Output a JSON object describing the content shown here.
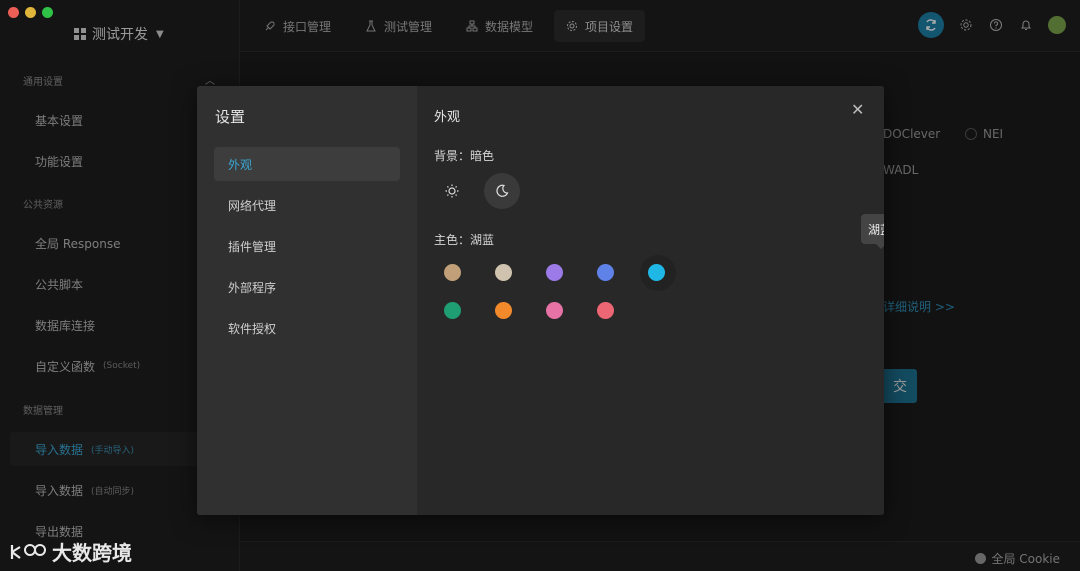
{
  "app": {
    "project_name": "测试开发"
  },
  "sidebar": {
    "sections": [
      {
        "title": "通用设置",
        "items": [
          {
            "label": "基本设置",
            "sub": ""
          },
          {
            "label": "功能设置",
            "sub": ""
          }
        ]
      },
      {
        "title": "公共资源",
        "items": [
          {
            "label": "全局 Response",
            "sub": ""
          },
          {
            "label": "公共脚本",
            "sub": ""
          },
          {
            "label": "数据库连接",
            "sub": ""
          },
          {
            "label": "自定义函数",
            "sub": "(Socket)"
          }
        ]
      },
      {
        "title": "数据管理",
        "items": [
          {
            "label": "导入数据",
            "sub": "(手动导入)"
          },
          {
            "label": "导入数据",
            "sub": "(自动同步)"
          },
          {
            "label": "导出数据",
            "sub": ""
          }
        ]
      }
    ]
  },
  "topnav": {
    "tabs": [
      {
        "label": "接口管理",
        "icon": "rocket-icon"
      },
      {
        "label": "测试管理",
        "icon": "flask-icon"
      },
      {
        "label": "数据模型",
        "icon": "model-icon"
      },
      {
        "label": "项目设置",
        "icon": "gear-icon",
        "active": true
      }
    ]
  },
  "background": {
    "options": [
      "DOClever",
      "NEI",
      "WADL"
    ],
    "link_text": "详细说明 >>",
    "button_label": "交"
  },
  "footer": {
    "cookie_label": "全局 Cookie",
    "watermark": "大数跨境"
  },
  "modal": {
    "title": "设置",
    "menu": [
      "外观",
      "网络代理",
      "插件管理",
      "外部程序",
      "软件授权"
    ],
    "active_menu": "外观",
    "pane_title": "外观",
    "background_label": "背景：暗色",
    "theme_modes": [
      "light",
      "dark"
    ],
    "selected_mode": "dark",
    "color_label": "主色：湖蓝",
    "colors": [
      {
        "name": "",
        "hex": "#c09f79"
      },
      {
        "name": "",
        "hex": "#cfc2ae"
      },
      {
        "name": "",
        "hex": "#9c7be8"
      },
      {
        "name": "",
        "hex": "#5f82e8"
      },
      {
        "name": "湖蓝",
        "hex": "#1fb8e6"
      },
      {
        "name": "",
        "hex": "#1e9e72"
      },
      {
        "name": "",
        "hex": "#f28a2c"
      },
      {
        "name": "",
        "hex": "#e672a6"
      },
      {
        "name": "",
        "hex": "#ec6674"
      }
    ],
    "selected_color": "湖蓝",
    "tooltip": "湖蓝"
  },
  "colors": {
    "accent": "#3aa7d6",
    "sync_button": "#1b7fa5"
  }
}
